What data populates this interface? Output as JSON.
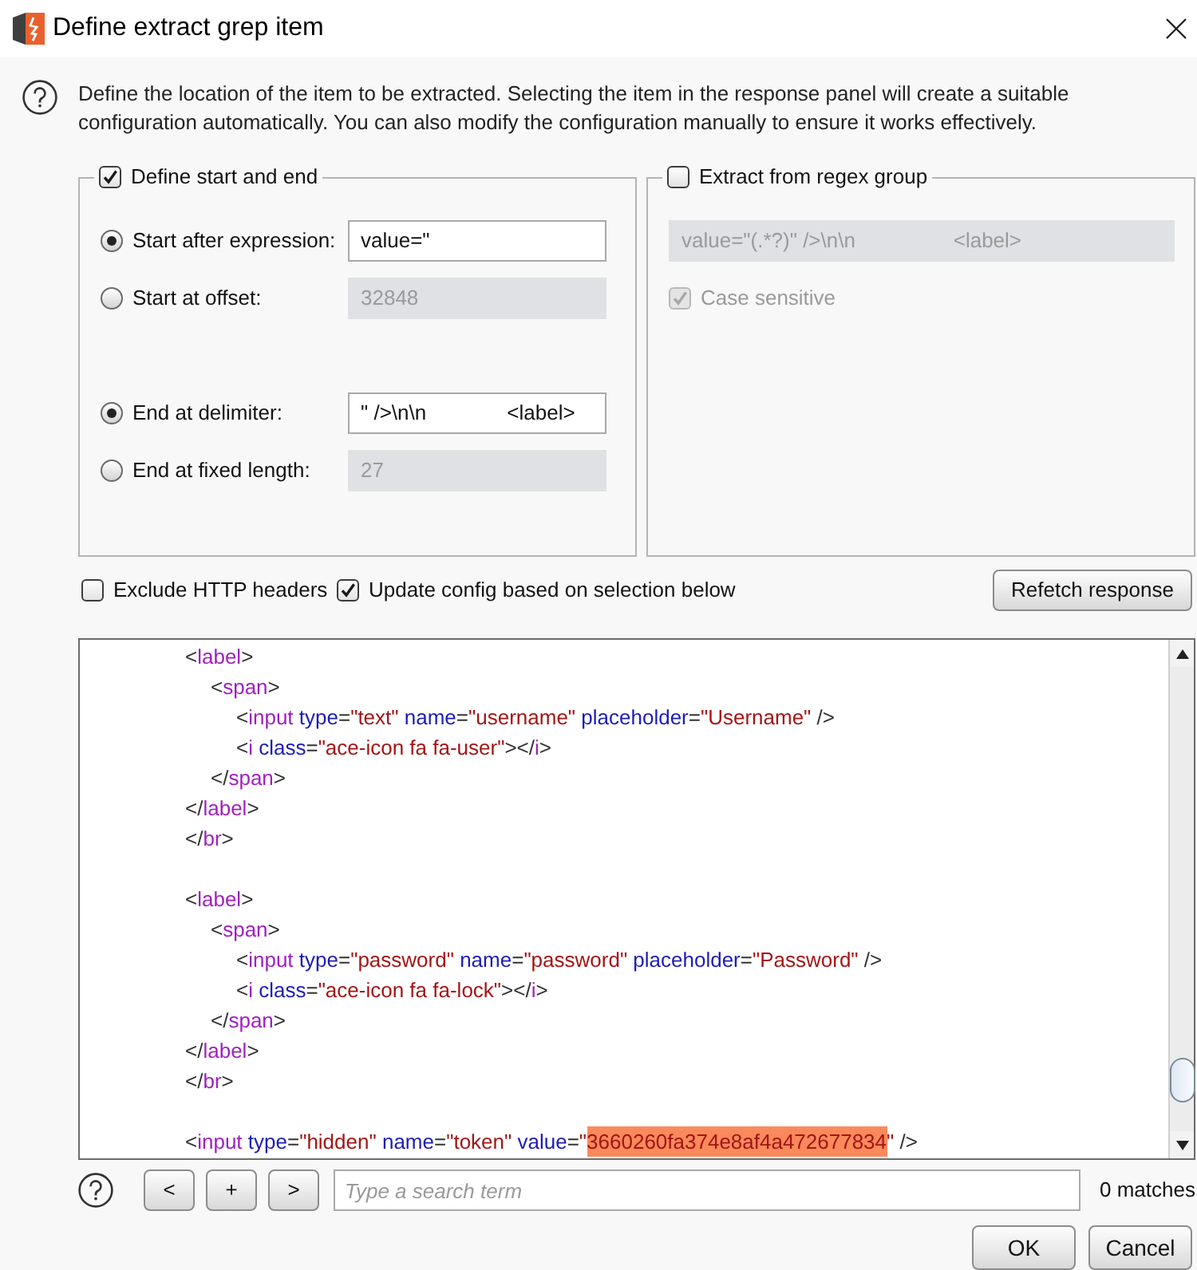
{
  "window": {
    "title": "Define extract grep item"
  },
  "help": {
    "text": "Define the location of the item to be extracted. Selecting the item in the response panel will create a suitable configuration automatically. You can also modify the configuration manually to ensure it works effectively."
  },
  "start_end": {
    "label": "Define start and end",
    "checked": true,
    "start_options": [
      {
        "label": "Start after expression:",
        "selected": true,
        "field": {
          "value": "value=\"",
          "disabled": false
        }
      },
      {
        "label": "Start at offset:",
        "selected": false,
        "field": {
          "value": "32848",
          "disabled": true
        }
      }
    ],
    "end_options": [
      {
        "label": "End at delimiter:",
        "selected": true,
        "field": {
          "value": "\" />\\n\\n              <label>",
          "disabled": false
        }
      },
      {
        "label": "End at fixed length:",
        "selected": false,
        "field": {
          "value": "27",
          "disabled": true
        }
      }
    ]
  },
  "regex_group": {
    "label": "Extract from regex group",
    "checked": false,
    "field": {
      "value": "value=\"(.*?)\" />\\n\\n                 <label>",
      "disabled": true
    },
    "case_sensitive": {
      "label": "Case sensitive",
      "checked": true,
      "disabled": true
    }
  },
  "options": [
    {
      "label": "Exclude HTTP headers",
      "checked": false
    },
    {
      "label": "Update config based on selection below",
      "checked": true
    }
  ],
  "refetch_button": "Refetch response",
  "editor": {
    "lines": [
      {
        "kind": "code",
        "tokens": [
          {
            "kind": "punct",
            "text": "<"
          },
          {
            "kind": "tag",
            "text": "label"
          },
          {
            "kind": "punct",
            "text": ">"
          }
        ],
        "children": [
          {
            "kind": "code",
            "tokens": [
              {
                "kind": "punct",
                "text": "<"
              },
              {
                "kind": "tag",
                "text": "span"
              },
              {
                "kind": "punct",
                "text": ">"
              }
            ],
            "children": [
              {
                "kind": "code",
                "tokens": [
                  {
                    "kind": "punct",
                    "text": "<"
                  },
                  {
                    "kind": "tag",
                    "text": "input"
                  },
                  {
                    "kind": "attr",
                    "text": " type"
                  },
                  {
                    "kind": "punct",
                    "text": "="
                  },
                  {
                    "kind": "value",
                    "text": "\"text\""
                  },
                  {
                    "kind": "attr",
                    "text": " name"
                  },
                  {
                    "kind": "punct",
                    "text": "="
                  },
                  {
                    "kind": "value",
                    "text": "\"username\""
                  },
                  {
                    "kind": "attr",
                    "text": " placeholder"
                  },
                  {
                    "kind": "punct",
                    "text": "="
                  },
                  {
                    "kind": "value",
                    "text": "\"Username\""
                  },
                  {
                    "kind": "punct",
                    "text": " />"
                  }
                ]
              },
              {
                "kind": "code",
                "tokens": [
                  {
                    "kind": "punct",
                    "text": "<"
                  },
                  {
                    "kind": "tag",
                    "text": "i"
                  },
                  {
                    "kind": "attr",
                    "text": " class"
                  },
                  {
                    "kind": "punct",
                    "text": "="
                  },
                  {
                    "kind": "value",
                    "text": "\"ace-icon fa fa-user\""
                  },
                  {
                    "kind": "punct",
                    "text": "></"
                  },
                  {
                    "kind": "tag",
                    "text": "i"
                  },
                  {
                    "kind": "punct",
                    "text": ">"
                  }
                ]
              }
            ]
          },
          {
            "kind": "code",
            "tokens": [
              {
                "kind": "punct",
                "text": "</"
              },
              {
                "kind": "tag",
                "text": "span"
              },
              {
                "kind": "punct",
                "text": ">"
              }
            ]
          }
        ]
      },
      {
        "kind": "code",
        "tokens": [
          {
            "kind": "punct",
            "text": "</"
          },
          {
            "kind": "tag",
            "text": "label"
          },
          {
            "kind": "punct",
            "text": ">"
          }
        ]
      },
      {
        "kind": "code",
        "tokens": [
          {
            "kind": "punct",
            "text": "</"
          },
          {
            "kind": "tag",
            "text": "br"
          },
          {
            "kind": "punct",
            "text": ">"
          }
        ]
      },
      {
        "kind": "blank"
      },
      {
        "kind": "code",
        "tokens": [
          {
            "kind": "punct",
            "text": "<"
          },
          {
            "kind": "tag",
            "text": "label"
          },
          {
            "kind": "punct",
            "text": ">"
          }
        ],
        "children": [
          {
            "kind": "code",
            "tokens": [
              {
                "kind": "punct",
                "text": "<"
              },
              {
                "kind": "tag",
                "text": "span"
              },
              {
                "kind": "punct",
                "text": ">"
              }
            ],
            "children": [
              {
                "kind": "code",
                "tokens": [
                  {
                    "kind": "punct",
                    "text": "<"
                  },
                  {
                    "kind": "tag",
                    "text": "input"
                  },
                  {
                    "kind": "attr",
                    "text": " type"
                  },
                  {
                    "kind": "punct",
                    "text": "="
                  },
                  {
                    "kind": "value",
                    "text": "\"password\""
                  },
                  {
                    "kind": "attr",
                    "text": " name"
                  },
                  {
                    "kind": "punct",
                    "text": "="
                  },
                  {
                    "kind": "value",
                    "text": "\"password\""
                  },
                  {
                    "kind": "attr",
                    "text": " placeholder"
                  },
                  {
                    "kind": "punct",
                    "text": "="
                  },
                  {
                    "kind": "value",
                    "text": "\"Password\""
                  },
                  {
                    "kind": "punct",
                    "text": " />"
                  }
                ]
              },
              {
                "kind": "code",
                "tokens": [
                  {
                    "kind": "punct",
                    "text": "<"
                  },
                  {
                    "kind": "tag",
                    "text": "i"
                  },
                  {
                    "kind": "attr",
                    "text": " class"
                  },
                  {
                    "kind": "punct",
                    "text": "="
                  },
                  {
                    "kind": "value",
                    "text": "\"ace-icon fa fa-lock\""
                  },
                  {
                    "kind": "punct",
                    "text": "></"
                  },
                  {
                    "kind": "tag",
                    "text": "i"
                  },
                  {
                    "kind": "punct",
                    "text": ">"
                  }
                ]
              }
            ]
          },
          {
            "kind": "code",
            "tokens": [
              {
                "kind": "punct",
                "text": "</"
              },
              {
                "kind": "tag",
                "text": "span"
              },
              {
                "kind": "punct",
                "text": ">"
              }
            ]
          }
        ]
      },
      {
        "kind": "code",
        "tokens": [
          {
            "kind": "punct",
            "text": "</"
          },
          {
            "kind": "tag",
            "text": "label"
          },
          {
            "kind": "punct",
            "text": ">"
          }
        ]
      },
      {
        "kind": "code",
        "tokens": [
          {
            "kind": "punct",
            "text": "</"
          },
          {
            "kind": "tag",
            "text": "br"
          },
          {
            "kind": "punct",
            "text": ">"
          }
        ]
      },
      {
        "kind": "blank"
      },
      {
        "kind": "code",
        "tokens": [
          {
            "kind": "punct",
            "text": "<"
          },
          {
            "kind": "tag",
            "text": "input"
          },
          {
            "kind": "attr",
            "text": " type"
          },
          {
            "kind": "punct",
            "text": "="
          },
          {
            "kind": "value",
            "text": "\"hidden\""
          },
          {
            "kind": "attr",
            "text": " name"
          },
          {
            "kind": "punct",
            "text": "="
          },
          {
            "kind": "value",
            "text": "\"token\""
          },
          {
            "kind": "attr",
            "text": " value"
          },
          {
            "kind": "punct",
            "text": "="
          },
          {
            "kind": "value",
            "text": "\""
          },
          {
            "kind": "selection",
            "text": "3660260fa374e8af4a472677834"
          },
          {
            "kind": "value",
            "text": "\""
          },
          {
            "kind": "punct",
            "text": " />"
          }
        ]
      }
    ]
  },
  "search": {
    "buttons": [
      "<",
      "+",
      ">"
    ],
    "placeholder": "Type a search term",
    "matches": "0 matches"
  },
  "footer_buttons": [
    "OK",
    "Cancel"
  ]
}
